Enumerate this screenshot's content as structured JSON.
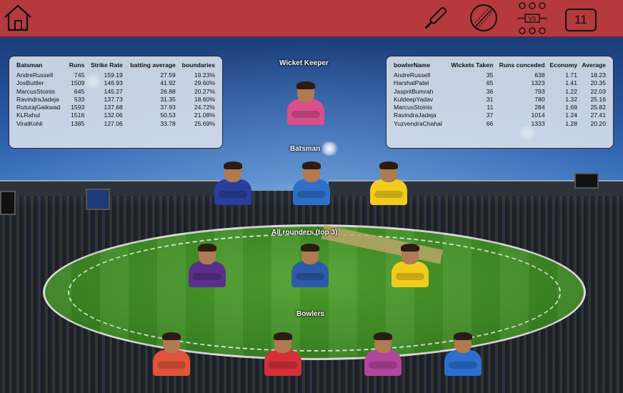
{
  "toolbar": {
    "home_icon": "home-icon",
    "bat_icon": "cricket-bat-icon",
    "ball_icon": "cricket-ball-icon",
    "vs_icon": "versus-lineup-icon",
    "vs_label": "VS",
    "eleven_label": "11",
    "bar_color": "#b53a3d"
  },
  "batting_table": {
    "headers": [
      "Batsman",
      "Runs",
      "Strike Rate",
      "batting average",
      "boundaries"
    ],
    "rows": [
      [
        "AndreRussell",
        "745",
        "159.19",
        "27.59",
        "19.23%"
      ],
      [
        "JosButtler",
        "1509",
        "146.93",
        "41.92",
        "29.60%"
      ],
      [
        "MarcusStoinis",
        "645",
        "145.27",
        "26.88",
        "20.27%"
      ],
      [
        "RavindraJadeja",
        "533",
        "137.73",
        "31.35",
        "18.60%"
      ],
      [
        "RuturajGaikwad",
        "1593",
        "137.68",
        "37.93",
        "24.72%"
      ],
      [
        "KLRahul",
        "1516",
        "132.06",
        "50.53",
        "21.08%"
      ],
      [
        "ViratKohli",
        "1385",
        "127.06",
        "33.78",
        "25.69%"
      ]
    ]
  },
  "bowling_table": {
    "headers": [
      "bowlerName",
      "Wickets Taken",
      "Runs conceded",
      "Economy",
      "Average"
    ],
    "rows": [
      [
        "AndreRussell",
        "35",
        "638",
        "1.71",
        "18.23"
      ],
      [
        "HarshalPatel",
        "65",
        "1323",
        "1.41",
        "20.35"
      ],
      [
        "JaspritBumrah",
        "36",
        "793",
        "1.22",
        "22.03"
      ],
      [
        "KuldeepYadav",
        "31",
        "780",
        "1.32",
        "25.16"
      ],
      [
        "MarcusStoinis",
        "11",
        "284",
        "1.69",
        "25.82"
      ],
      [
        "RavindraJadeja",
        "37",
        "1014",
        "1.24",
        "27.41"
      ],
      [
        "YuzvendraChahal",
        "66",
        "1333",
        "1.28",
        "20.20"
      ]
    ]
  },
  "sections": {
    "wicket_keeper": "Wicket Keeper",
    "batsman": "Batsman",
    "all_rounders": "All rounders (top 3)",
    "bowlers": "Bowlers"
  },
  "players": {
    "keeper": [
      {
        "jersey": "#d94f8c"
      }
    ],
    "batsmen": [
      {
        "jersey": "#2a3f9c"
      },
      {
        "jersey": "#2e6fc7"
      },
      {
        "jersey": "#f2cc1d"
      }
    ],
    "all_rounders": [
      {
        "jersey": "#5a2f8c"
      },
      {
        "jersey": "#2d5aa8"
      },
      {
        "jersey": "#f2cc1d"
      }
    ],
    "bowlers": [
      {
        "jersey": "#e2533a"
      },
      {
        "jersey": "#d62f3a"
      },
      {
        "jersey": "#b2459c"
      },
      {
        "jersey": "#2a6fd0"
      }
    ]
  }
}
